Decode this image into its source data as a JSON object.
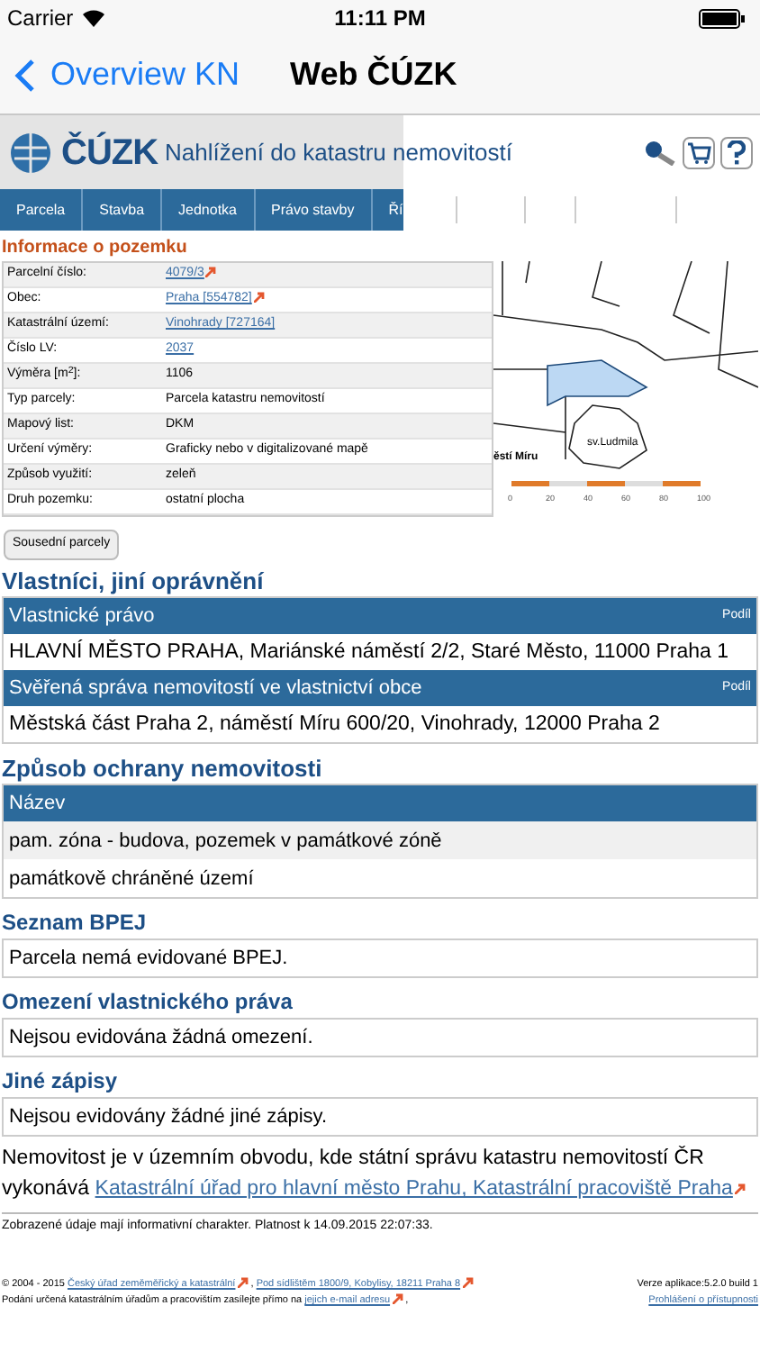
{
  "status_bar": {
    "carrier": "Carrier",
    "time": "11:11 PM"
  },
  "nav": {
    "back_label": "Overview KN",
    "title": "Web ČÚZK"
  },
  "header": {
    "logo_text": "ČÚZK",
    "title": "Nahlížení do katastru nemovitostí"
  },
  "tabs": [
    {
      "label": "Parcela"
    },
    {
      "label": "Stavba"
    },
    {
      "label": "Jednotka"
    },
    {
      "label": "Právo stavby"
    },
    {
      "label": "Ří"
    }
  ],
  "parcel": {
    "heading": "Informace o pozemku",
    "rows": [
      {
        "label": "Parcelní číslo:",
        "value": "4079/3",
        "kind": "link",
        "external": true
      },
      {
        "label": "Obec:",
        "value": "Praha [554782]",
        "kind": "link",
        "external": true
      },
      {
        "label": "Katastrální území:",
        "value": "Vinohrady [727164]",
        "kind": "link",
        "external": false
      },
      {
        "label": "Číslo LV:",
        "value": "2037",
        "kind": "link",
        "external": false
      },
      {
        "label": "Výměra [m$^{2}$]:",
        "value": "1106",
        "kind": "text"
      },
      {
        "label": "Typ parcely:",
        "value": "Parcela katastru nemovitostí",
        "kind": "text"
      },
      {
        "label": "Mapový list:",
        "value": "DKM",
        "kind": "text"
      },
      {
        "label": "Určení výměry:",
        "value": "Graficky nebo v digitalizované mapě",
        "kind": "text"
      },
      {
        "label": "Způsob využití:",
        "value": "zeleň",
        "kind": "text"
      },
      {
        "label": "Druh pozemku:",
        "value": "ostatní plocha",
        "kind": "text"
      }
    ]
  },
  "map": {
    "labels": [
      "ěstí Míru",
      "sv.Ludmila"
    ],
    "scale": [
      "0",
      "20",
      "40",
      "60",
      "80",
      "100"
    ]
  },
  "neighbors_button": "Sousední parcely",
  "owners": {
    "heading": "Vlastníci, jiní oprávnění",
    "groups": [
      {
        "header": "Vlastnické právo",
        "share": "Podíl",
        "entry": "HLAVNÍ MĚSTO PRAHA, Mariánské náměstí 2/2, Staré Město, 11000 Praha 1"
      },
      {
        "header": "Svěřená správa nemovitostí ve vlastnictví obce",
        "share": "Podíl",
        "entry": "Městská část Praha 2, náměstí Míru 600/20, Vinohrady, 12000 Praha 2"
      }
    ]
  },
  "protection": {
    "heading": "Způsob ochrany nemovitosti",
    "column": "Název",
    "rows": [
      "pam. zóna - budova, pozemek v památkové zóně",
      "památkově chráněné území"
    ]
  },
  "sections": [
    {
      "heading": "Seznam BPEJ",
      "text": "Parcela nemá evidované BPEJ."
    },
    {
      "heading": "Omezení vlastnického práva",
      "text": "Nejsou evidována žádná omezení."
    },
    {
      "heading": "Jiné zápisy",
      "text": "Nejsou evidovány žádné jiné zápisy."
    }
  ],
  "office_note": {
    "text": "Nemovitost je v územním obvodu, kde státní správu katastru nemovitostí ČR vykonává",
    "link": "Katastrální úřad pro hlavní město Prahu, Katastrální pracoviště Praha"
  },
  "validity": "Zobrazené údaje mají informativní charakter. Platnost k 14.09.2015 22:07:33.",
  "footer": {
    "copyright": "© 2004 - 2015",
    "office_link": "Český úřad zeměměřický a katastrální",
    "separator": ",",
    "address_link": "Pod sídlištěm 1800/9, Kobylisy, 18211 Praha 8",
    "submission_text": "Podání určená katastrálním úřadům a pracovištím zasílejte přímo na",
    "email_link": "jejich e-mail adresu",
    "end": ",",
    "version": "Verze aplikace:5.2.0 build 1",
    "accessibility_link": "Prohlášení o přístupnosti"
  }
}
